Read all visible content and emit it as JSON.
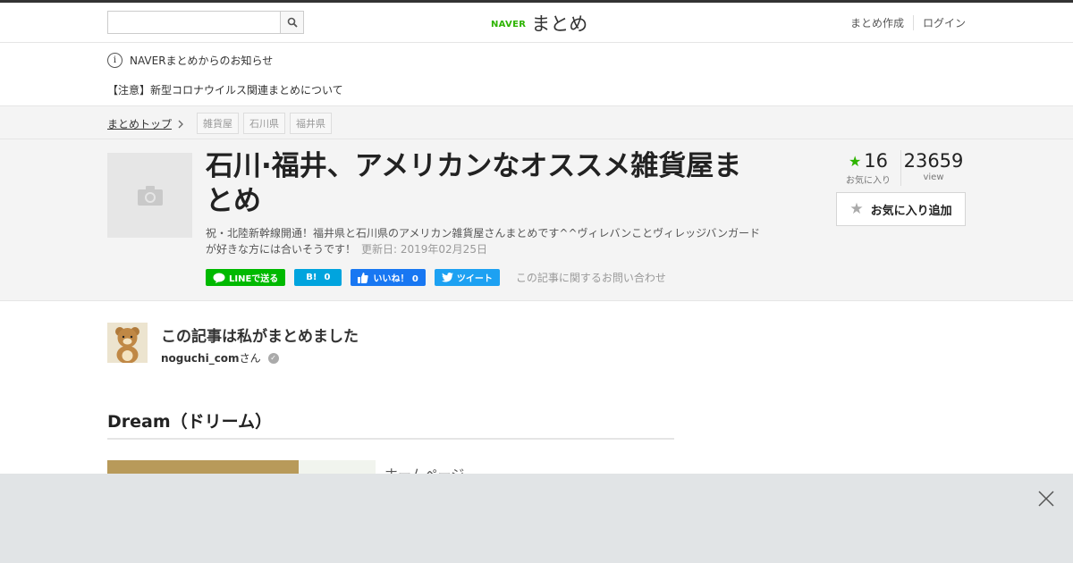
{
  "header": {
    "search_placeholder": "",
    "logo_naver": "NAVER",
    "logo_matome": "まとめ",
    "links": [
      "まとめ作成",
      "ログイン"
    ]
  },
  "notice": {
    "title": "NAVERまとめからのお知らせ",
    "message": "【注意】新型コロナウイルス関連まとめについて"
  },
  "breadcrumb": {
    "top": "まとめトップ",
    "tags": [
      "雑貨屋",
      "石川県",
      "福井県"
    ]
  },
  "article": {
    "title": "石川·福井、アメリカンなオススメ雑貨屋まとめ",
    "description": "祝・北陸新幹線開通！福井県と石川県のアメリカン雑貨屋さんまとめです^^ヴィレバンことヴィレッジバンガードが好きな方には合いそうです！",
    "updated": "更新日: 2019年02月25日",
    "share": {
      "line": "LINEで送る",
      "hatena": "0",
      "fb": "いいね！ 0",
      "tw": "ツイート"
    },
    "contact": "この記事に関するお問い合わせ",
    "favorites": "16",
    "favorites_label": "お気に入り",
    "views": "23659",
    "views_label": "view",
    "fav_button": "お気に入り追加"
  },
  "author": {
    "heading": "この記事は私がまとめました",
    "name": "noguchi_com",
    "suffix": "さん"
  },
  "content": {
    "section_title": "Dream（ドリーム）",
    "homepage": "ホームページ"
  },
  "colors": {
    "brand_green": "#2db400",
    "line_green": "#00b900",
    "hatena_blue": "#00a4de",
    "fb_blue": "#1877f2",
    "twitter_blue": "#1da1f2"
  }
}
